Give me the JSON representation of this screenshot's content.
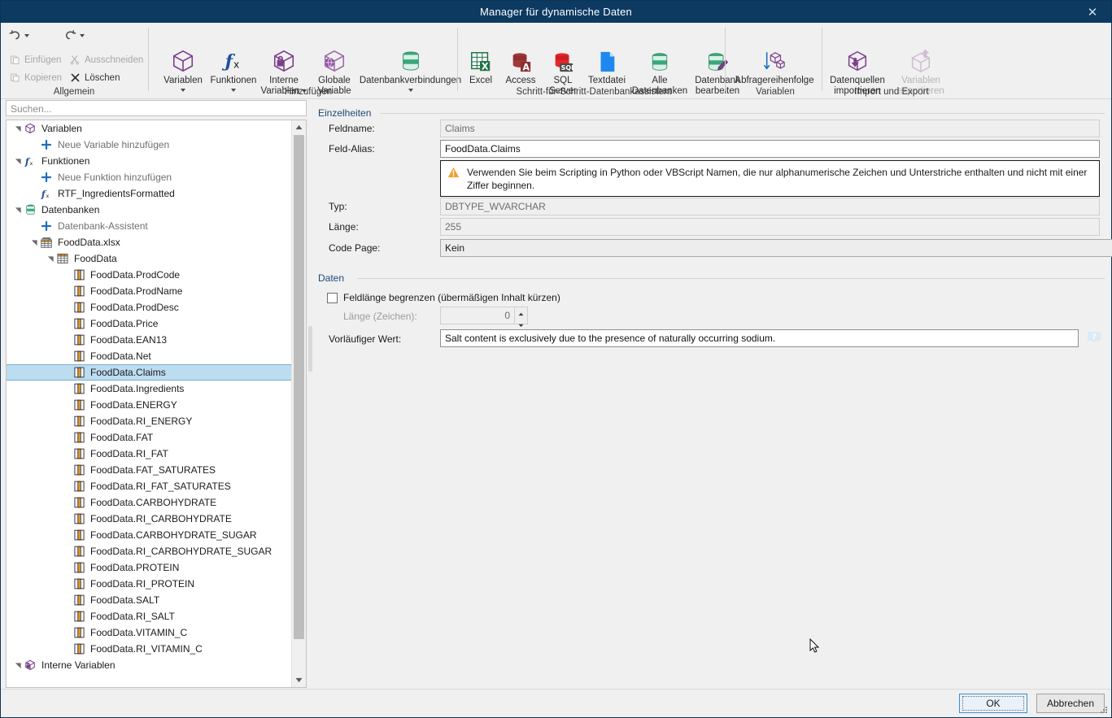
{
  "window": {
    "title": "Manager für dynamische Daten",
    "close_label": "✕"
  },
  "ribbon": {
    "groups": [
      {
        "label": "Allgemein"
      },
      {
        "label": "Hinzufügen"
      },
      {
        "label": "Schritt-für-Schritt-Datenbankassistent"
      },
      {
        "label": "Variablen"
      },
      {
        "label": "Import und Export"
      }
    ],
    "general": {
      "undo": "",
      "redo": "",
      "paste": "Einfügen",
      "cut": "Ausschneiden",
      "copy": "Kopieren",
      "delete": "Löschen"
    },
    "add": [
      {
        "label": "Variablen",
        "caret": true
      },
      {
        "label": "Funktionen",
        "caret": true
      },
      {
        "label": "Interne\nVariablen",
        "caret": true
      },
      {
        "label": "Globale\nVariable",
        "caret": false
      },
      {
        "label": "Datenbankverbindungen",
        "caret": true
      }
    ],
    "wizard": [
      {
        "label": "Excel"
      },
      {
        "label": "Access"
      },
      {
        "label": "SQL\nServer"
      },
      {
        "label": "Textdatei"
      },
      {
        "label": "Alle\nDatenbanken"
      },
      {
        "label": "Datenbank\nbearbeiten"
      }
    ],
    "variables": [
      {
        "label": "Abfragereihenfolge"
      }
    ],
    "importexport": [
      {
        "label": "Datenquellen\nimportieren",
        "disabled": false
      },
      {
        "label": "Variablen\nexportieren",
        "disabled": true
      }
    ]
  },
  "sidebar": {
    "search_placeholder": "Suchen...",
    "tree": [
      {
        "label": "Variablen",
        "indent": 0,
        "icon": "cube-icon",
        "twisty": "open",
        "muted": false
      },
      {
        "label": "Neue Variable hinzufügen",
        "indent": 1,
        "icon": "plus-icon",
        "twisty": "none",
        "muted": true
      },
      {
        "label": "Funktionen",
        "indent": 0,
        "icon": "function-icon",
        "twisty": "open",
        "muted": false
      },
      {
        "label": "Neue Funktion hinzufügen",
        "indent": 1,
        "icon": "plus-icon",
        "twisty": "none",
        "muted": true
      },
      {
        "label": "RTF_IngredientsFormatted",
        "indent": 1,
        "icon": "function-icon",
        "twisty": "none",
        "muted": false
      },
      {
        "label": "Datenbanken",
        "indent": 0,
        "icon": "database-icon",
        "twisty": "open",
        "muted": false
      },
      {
        "label": "Datenbank-Assistent",
        "indent": 1,
        "icon": "plus-icon",
        "twisty": "none",
        "muted": true
      },
      {
        "label": "FoodData.xlsx",
        "indent": 1,
        "icon": "workbook-icon",
        "twisty": "open",
        "muted": false
      },
      {
        "label": "FoodData",
        "indent": 2,
        "icon": "table-icon",
        "twisty": "open",
        "muted": false
      },
      {
        "label": "FoodData.ProdCode",
        "indent": 3,
        "icon": "column-icon",
        "twisty": "none",
        "muted": false
      },
      {
        "label": "FoodData.ProdName",
        "indent": 3,
        "icon": "column-icon",
        "twisty": "none",
        "muted": false
      },
      {
        "label": "FoodData.ProdDesc",
        "indent": 3,
        "icon": "column-icon",
        "twisty": "none",
        "muted": false
      },
      {
        "label": "FoodData.Price",
        "indent": 3,
        "icon": "column-icon",
        "twisty": "none",
        "muted": false
      },
      {
        "label": "FoodData.EAN13",
        "indent": 3,
        "icon": "column-icon",
        "twisty": "none",
        "muted": false
      },
      {
        "label": "FoodData.Net",
        "indent": 3,
        "icon": "column-icon",
        "twisty": "none",
        "muted": false
      },
      {
        "label": "FoodData.Claims",
        "indent": 3,
        "icon": "column-icon",
        "twisty": "none",
        "muted": false,
        "selected": true
      },
      {
        "label": "FoodData.Ingredients",
        "indent": 3,
        "icon": "column-icon",
        "twisty": "none",
        "muted": false
      },
      {
        "label": "FoodData.ENERGY",
        "indent": 3,
        "icon": "column-icon",
        "twisty": "none",
        "muted": false
      },
      {
        "label": "FoodData.RI_ENERGY",
        "indent": 3,
        "icon": "column-icon",
        "twisty": "none",
        "muted": false
      },
      {
        "label": "FoodData.FAT",
        "indent": 3,
        "icon": "column-icon",
        "twisty": "none",
        "muted": false
      },
      {
        "label": "FoodData.RI_FAT",
        "indent": 3,
        "icon": "column-icon",
        "twisty": "none",
        "muted": false
      },
      {
        "label": "FoodData.FAT_SATURATES",
        "indent": 3,
        "icon": "column-icon",
        "twisty": "none",
        "muted": false
      },
      {
        "label": "FoodData.RI_FAT_SATURATES",
        "indent": 3,
        "icon": "column-icon",
        "twisty": "none",
        "muted": false
      },
      {
        "label": "FoodData.CARBOHYDRATE",
        "indent": 3,
        "icon": "column-icon",
        "twisty": "none",
        "muted": false
      },
      {
        "label": "FoodData.RI_CARBOHYDRATE",
        "indent": 3,
        "icon": "column-icon",
        "twisty": "none",
        "muted": false
      },
      {
        "label": "FoodData.CARBOHYDRATE_SUGAR",
        "indent": 3,
        "icon": "column-icon",
        "twisty": "none",
        "muted": false
      },
      {
        "label": "FoodData.RI_CARBOHYDRATE_SUGAR",
        "indent": 3,
        "icon": "column-icon",
        "twisty": "none",
        "muted": false
      },
      {
        "label": "FoodData.PROTEIN",
        "indent": 3,
        "icon": "column-icon",
        "twisty": "none",
        "muted": false
      },
      {
        "label": "FoodData.RI_PROTEIN",
        "indent": 3,
        "icon": "column-icon",
        "twisty": "none",
        "muted": false
      },
      {
        "label": "FoodData.SALT",
        "indent": 3,
        "icon": "column-icon",
        "twisty": "none",
        "muted": false
      },
      {
        "label": "FoodData.RI_SALT",
        "indent": 3,
        "icon": "column-icon",
        "twisty": "none",
        "muted": false
      },
      {
        "label": "FoodData.VITAMIN_C",
        "indent": 3,
        "icon": "column-icon",
        "twisty": "none",
        "muted": false
      },
      {
        "label": "FoodData.RI_VITAMIN_C",
        "indent": 3,
        "icon": "column-icon",
        "twisty": "none",
        "muted": false
      },
      {
        "label": "Interne Variablen",
        "indent": 0,
        "icon": "internal-var-icon",
        "twisty": "open",
        "muted": false
      }
    ]
  },
  "details": {
    "section_title": "Einzelheiten",
    "fieldname_label": "Feldname:",
    "fieldname_value": "Claims",
    "alias_label": "Feld-Alias:",
    "alias_value": "FoodData.Claims",
    "warning_text": "Verwenden Sie beim Scripting in Python oder VBScript Namen, die nur alphanumerische Zeichen und Unterstriche enthalten und nicht mit einer Ziffer beginnen.",
    "type_label": "Typ:",
    "type_value": "DBTYPE_WVARCHAR",
    "length_label": "Länge:",
    "length_value": "255",
    "codepage_label": "Code Page:",
    "codepage_value": "Kein"
  },
  "data_section": {
    "section_title": "Daten",
    "limit_checkbox_label": "Feldlänge begrenzen (übermäßigen Inhalt kürzen)",
    "limit_checked": false,
    "length_chars_label": "Länge (Zeichen):",
    "length_chars_value": "0",
    "preliminary_label": "Vorläufiger Wert:",
    "preliminary_value": "Salt content is exclusively due to the presence of naturally occurring sodium."
  },
  "footer": {
    "ok_label": "OK",
    "cancel_label": "Abbrechen"
  },
  "colors": {
    "titlebar": "#0d3a61",
    "accent_purple": "#7b3f8c",
    "accent_green": "#2f9e6e",
    "accent_blue": "#1e6fbf",
    "excel_green": "#1e7145",
    "access_red": "#a4373a",
    "sql_red": "#e8252a",
    "selection": "#bcdcf0",
    "warning_orange": "#f0a030"
  }
}
